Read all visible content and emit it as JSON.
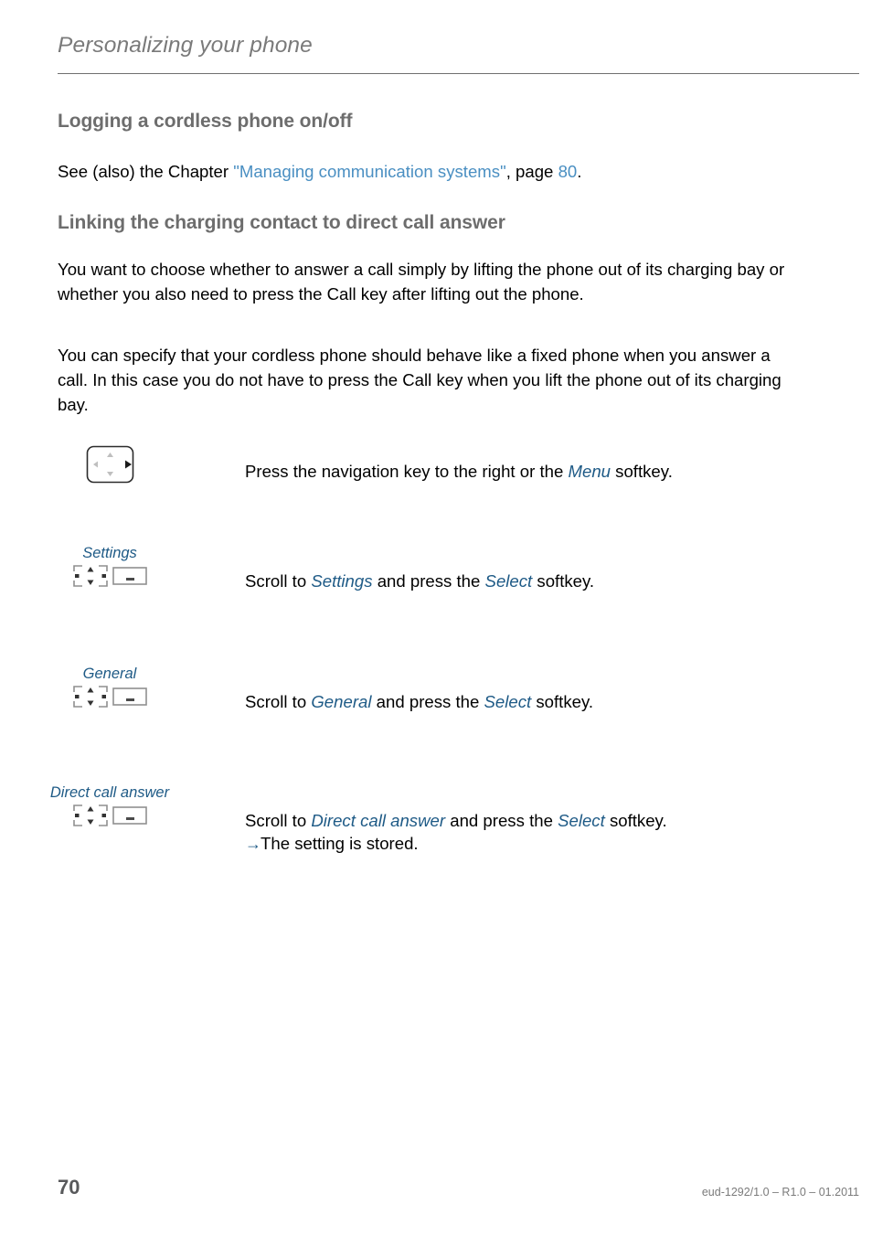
{
  "document": {
    "running_head": "Personalizing your phone",
    "sections": [
      {
        "heading": "Logging a cordless phone on/off",
        "paragraph_pre": "See (also) the Chapter ",
        "link_text": "\"Managing communication systems\"",
        "paragraph_mid": ", page ",
        "page_ref": "80",
        "paragraph_post": "."
      },
      {
        "heading": "Linking the charging contact to direct call answer",
        "paragraph_1": "You want to choose whether to answer a call simply by lifting the phone out of its charging bay or whether you also need to press the Call key after lifting out the phone.",
        "paragraph_2": "You can specify that your cordless phone should behave like a fixed phone when you answer a call. In this case you do not have to press the Call key when you lift the phone out of its charging bay."
      }
    ],
    "steps": [
      {
        "label": "",
        "icons": [
          "navigation-key-right-icon"
        ],
        "text_parts": [
          {
            "type": "plain",
            "value": "Press the navigation key to the right or the "
          },
          {
            "type": "emphasis",
            "value": "Menu"
          },
          {
            "type": "plain",
            "value": " softkey."
          }
        ],
        "note": ""
      },
      {
        "label": "Settings",
        "icons": [
          "navigation-key-icon",
          "softkey-icon"
        ],
        "text_parts": [
          {
            "type": "plain",
            "value": "Scroll to "
          },
          {
            "type": "emphasis",
            "value": "Settings"
          },
          {
            "type": "plain",
            "value": " and press the "
          },
          {
            "type": "emphasis",
            "value": "Select"
          },
          {
            "type": "plain",
            "value": " softkey."
          }
        ],
        "note": ""
      },
      {
        "label": "General",
        "icons": [
          "navigation-key-icon",
          "softkey-icon"
        ],
        "text_parts": [
          {
            "type": "plain",
            "value": "Scroll to "
          },
          {
            "type": "emphasis",
            "value": "General"
          },
          {
            "type": "plain",
            "value": " and press the "
          },
          {
            "type": "emphasis",
            "value": "Select"
          },
          {
            "type": "plain",
            "value": " softkey."
          }
        ],
        "note": ""
      },
      {
        "label": "Direct call answer",
        "icons": [
          "navigation-key-icon",
          "softkey-icon"
        ],
        "text_parts": [
          {
            "type": "plain",
            "value": "Scroll to "
          },
          {
            "type": "emphasis",
            "value": "Direct call answer"
          },
          {
            "type": "plain",
            "value": " and press the "
          },
          {
            "type": "emphasis",
            "value": "Select"
          },
          {
            "type": "plain",
            "value": " softkey."
          }
        ],
        "note_arrow": "→",
        "note": "The setting is stored."
      }
    ],
    "footer": {
      "page_number": "70",
      "document_id": "eud-1292/1.0 – R1.0 – 01.2011"
    },
    "colors": {
      "link_blue": "#4a8fc2",
      "emphasis_blue": "#1e5a86",
      "heading_gray": "#6d6d6d",
      "running_head_gray": "#7a7a7a",
      "footer_gray": "#7b7b7b"
    }
  }
}
